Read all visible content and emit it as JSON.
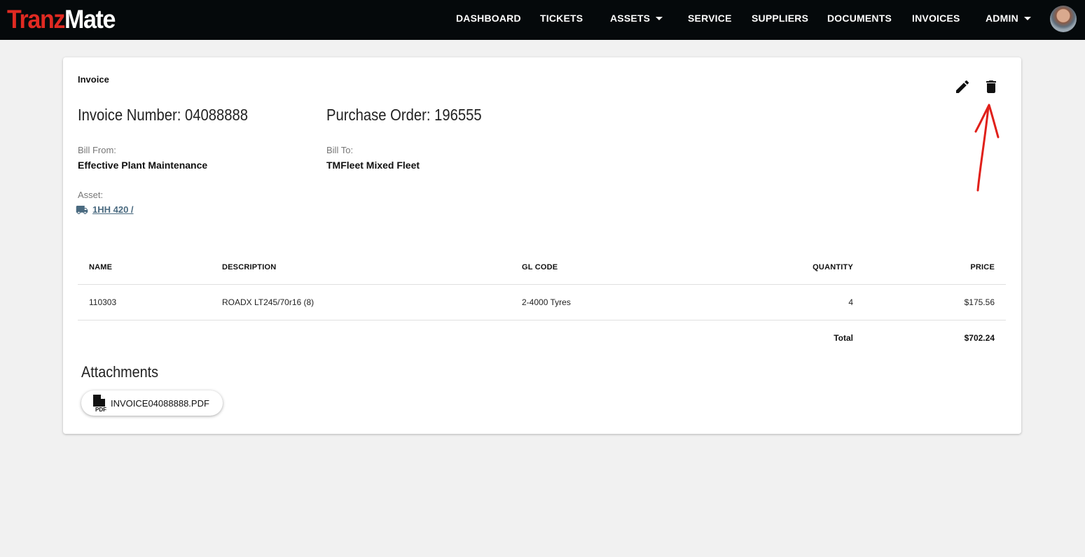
{
  "app": {
    "logo_part1": "Tranz",
    "logo_part2": "Mate",
    "nav": [
      {
        "label": "DASHBOARD"
      },
      {
        "label": "TICKETS"
      },
      {
        "label": "ASSETS"
      },
      {
        "label": "SERVICE"
      },
      {
        "label": "SUPPLIERS"
      },
      {
        "label": "DOCUMENTS"
      },
      {
        "label": "INVOICES"
      },
      {
        "label": "ADMIN"
      }
    ]
  },
  "invoice": {
    "card_title": "Invoice",
    "invoice_number": "Invoice Number: 04088888",
    "purchase_order": "Purchase Order: 196555",
    "bill_from_label": "Bill From:",
    "bill_from": "Effective Plant Maintenance",
    "bill_to_label": "Bill To:",
    "bill_to": "TMFleet Mixed Fleet",
    "asset_label": "Asset:",
    "asset_link": "1HH 420 /",
    "table": {
      "headers": [
        "NAME",
        "DESCRIPTION",
        "GL CODE",
        "QUANTITY",
        "PRICE"
      ],
      "rows": [
        [
          "110303",
          "ROADX LT245/70r16 (8)",
          "2-4000 Tyres",
          "4",
          "$175.56"
        ]
      ],
      "total_label": "Total",
      "total_value": "$702.24"
    },
    "attachments_title": "Attachments",
    "attachments": [
      {
        "filename": "INVOICE04088888.PDF",
        "icon": "pdf-file-icon",
        "icon_text": "PDF"
      }
    ]
  },
  "colors": {
    "topbar": "#05090b",
    "logo_red": "#e12a22",
    "link": "#4a6a80",
    "annotation": "#e0201a"
  },
  "icons": [
    "edit-icon",
    "delete-icon",
    "truck-icon",
    "pdf-file-icon",
    "chevron-down-icon"
  ]
}
